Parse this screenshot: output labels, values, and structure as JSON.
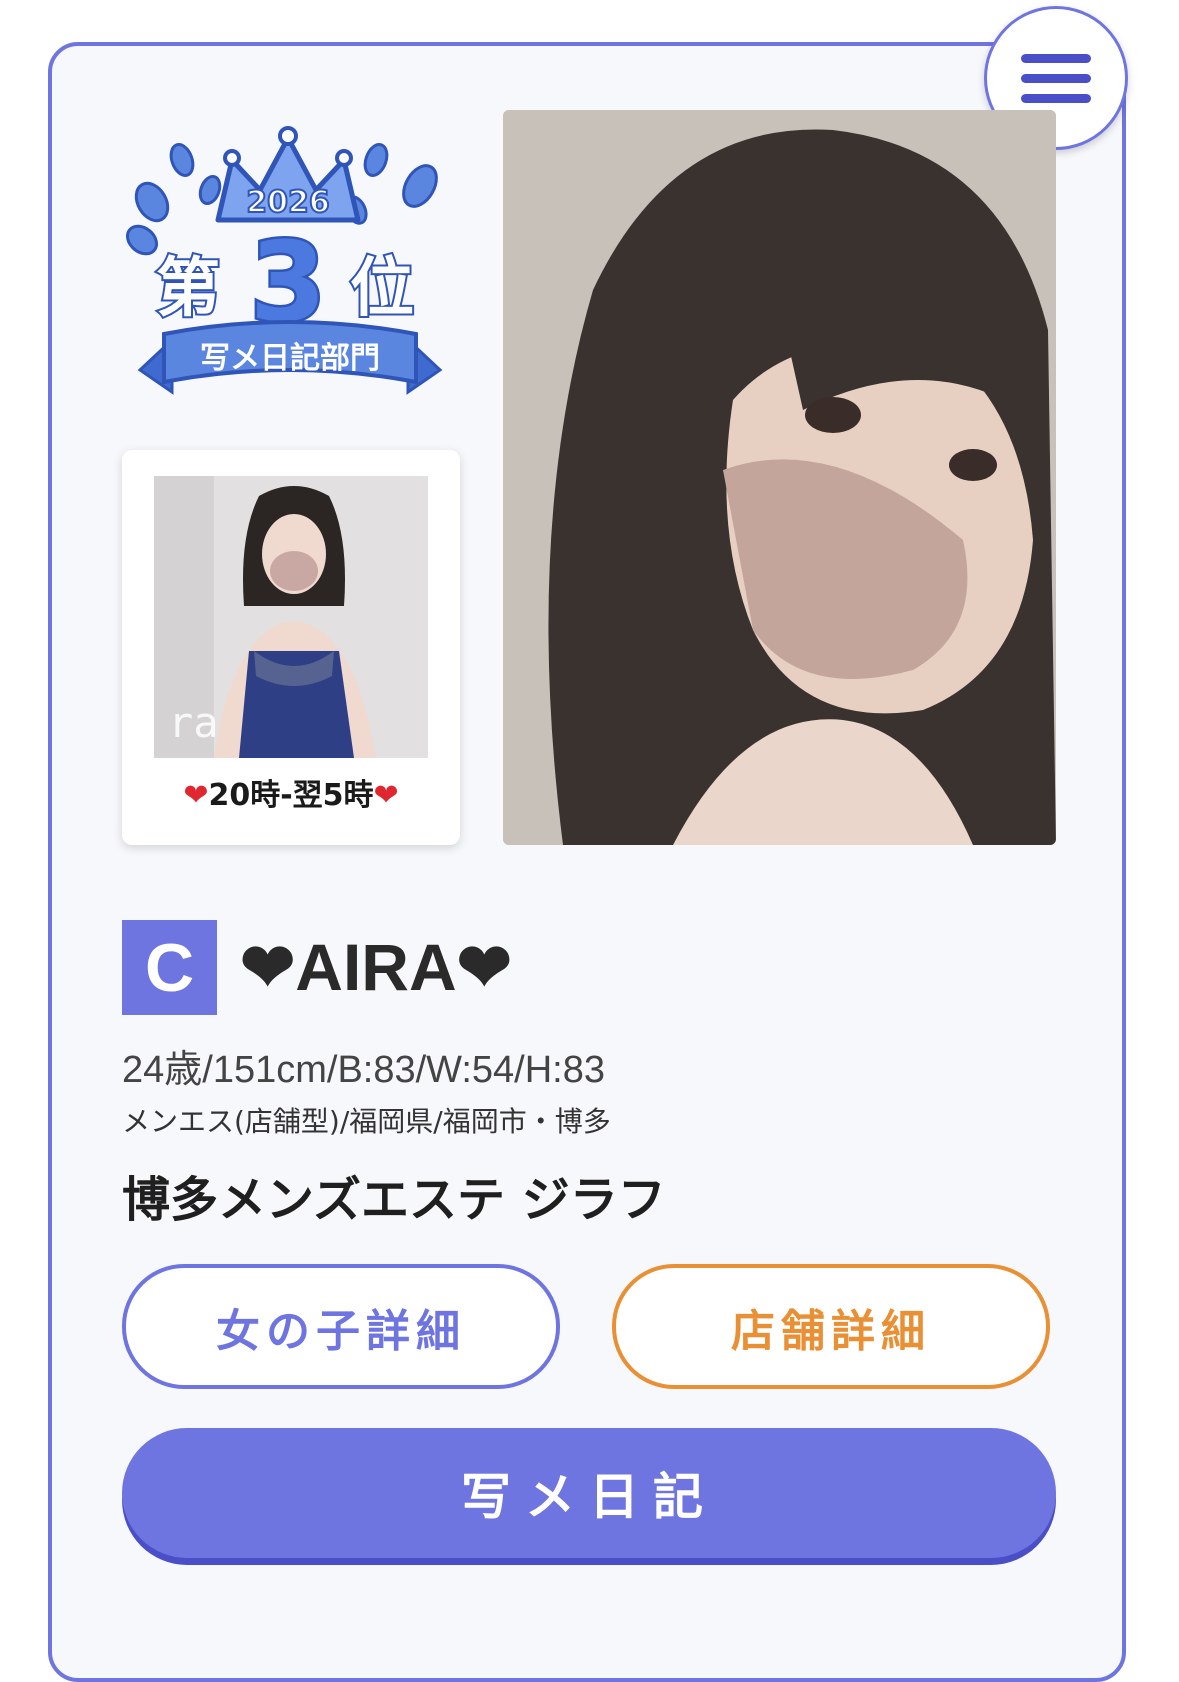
{
  "menu": {
    "icon": "hamburger-menu-icon"
  },
  "badge": {
    "year": "2026",
    "rank_prefix": "第",
    "rank_number": "3",
    "rank_suffix": "位",
    "department": "写メ日記部門"
  },
  "thumbnail": {
    "watermark": "ra",
    "caption": "20時-翌5時",
    "heart_icon": "❤"
  },
  "profile": {
    "grade": "C",
    "name": "❤AIRA❤",
    "stats": "24歳/151cm/B:83/W:54/H:83",
    "area": "メンエス(店舗型)/福岡県/福岡市・博多",
    "shop_name": "博多メンズエステ ジラフ"
  },
  "buttons": {
    "girl_detail": "女の子詳細",
    "shop_detail": "店舗詳細",
    "photo_diary": "写メ日記"
  },
  "colors": {
    "accent": "#6f75e0",
    "accent_dark": "#4a4fc8",
    "orange": "#e99035"
  }
}
